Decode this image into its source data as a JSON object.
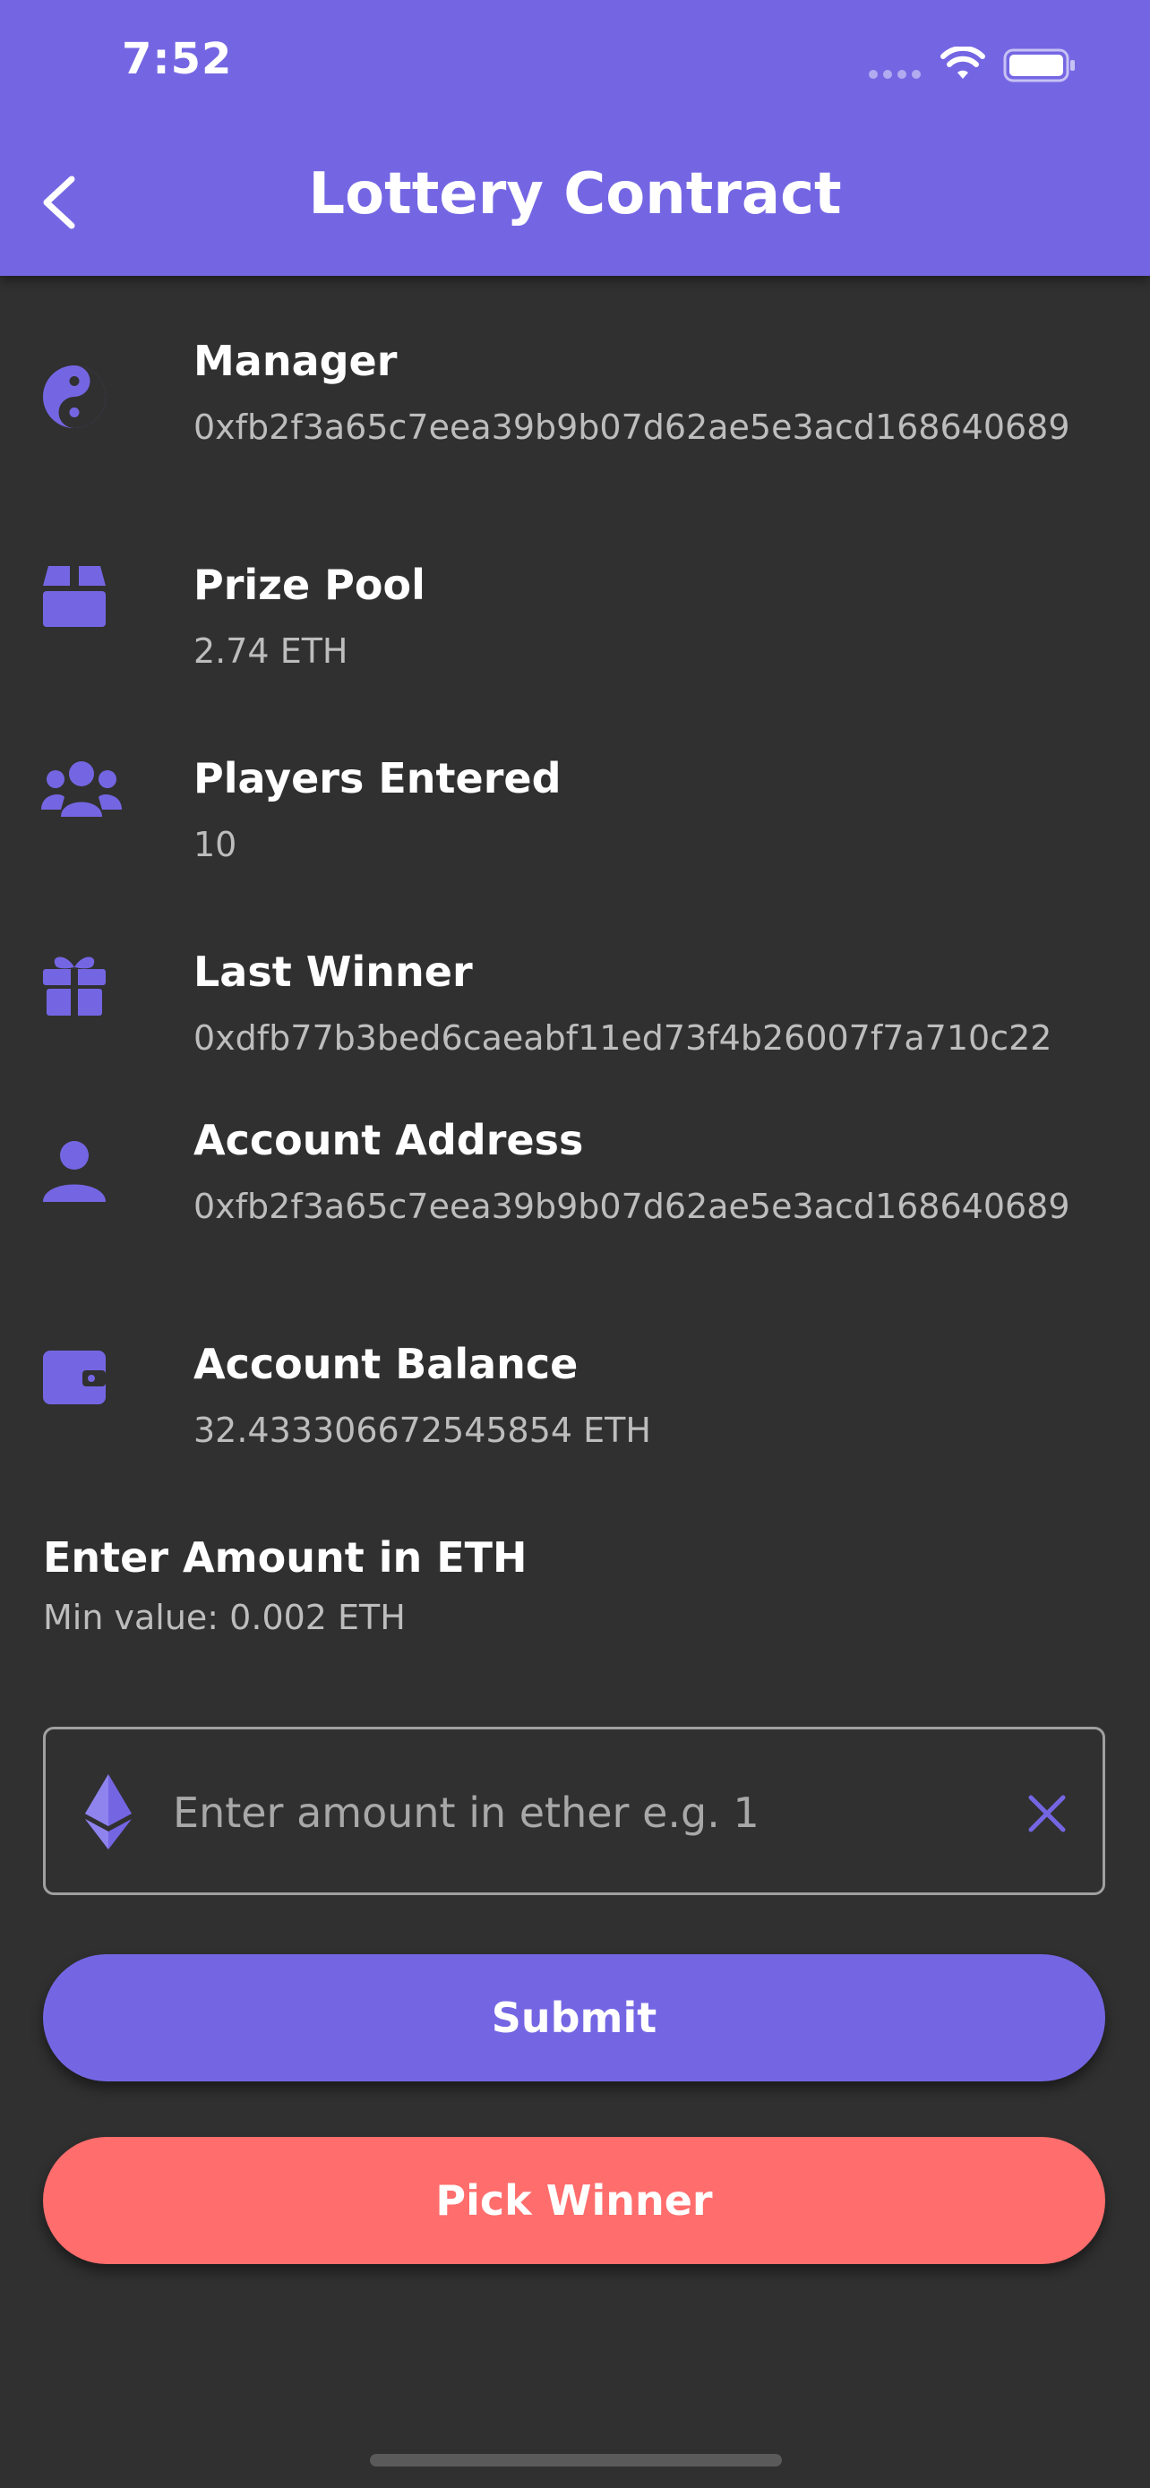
{
  "status_bar": {
    "time": "7:52"
  },
  "header": {
    "title": "Lottery Contract",
    "back_icon": "chevron-left-icon"
  },
  "info": {
    "manager": {
      "label": "Manager",
      "value": "0xfb2f3a65c7eea39b9b07d62ae5e3acd168640689",
      "icon": "yin-yang-icon"
    },
    "prize_pool": {
      "label": "Prize Pool",
      "value": "2.74 ETH",
      "icon": "box-icon"
    },
    "players": {
      "label": "Players Entered",
      "value": "10",
      "icon": "users-icon"
    },
    "last_winner": {
      "label": "Last Winner",
      "value": "0xdfb77b3bed6caeabf11ed73f4b26007f7a710c22",
      "icon": "gift-icon"
    },
    "account_address": {
      "label": "Account Address",
      "value": "0xfb2f3a65c7eea39b9b07d62ae5e3acd168640689",
      "icon": "user-icon"
    },
    "account_balance": {
      "label": "Account Balance",
      "value": "32.433306672545854 ETH",
      "icon": "wallet-icon"
    }
  },
  "amount": {
    "heading": "Enter Amount in ETH",
    "hint": "Min value: 0.002 ETH",
    "placeholder": "Enter amount in ether e.g. 1",
    "value": ""
  },
  "buttons": {
    "submit": "Submit",
    "pick_winner": "Pick Winner"
  },
  "colors": {
    "accent": "#7466E3",
    "danger": "#FF6D6D",
    "background": "#303030"
  }
}
